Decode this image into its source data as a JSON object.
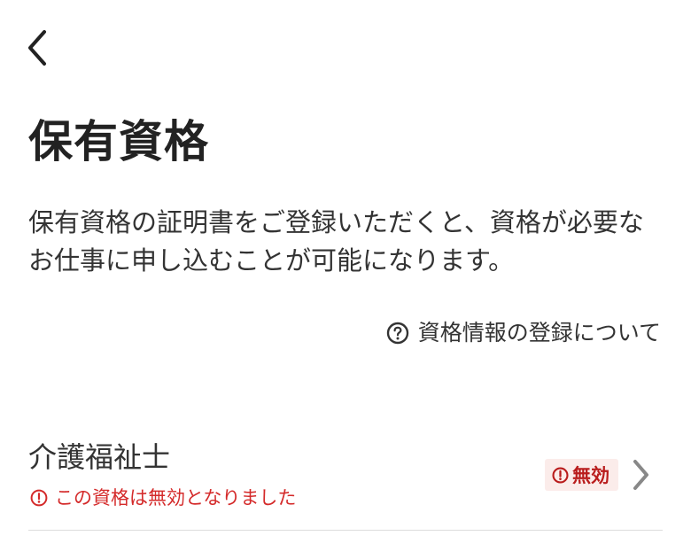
{
  "header": {
    "back_icon": "chevron-left-icon"
  },
  "page": {
    "title": "保有資格",
    "description": "保有資格の証明書をご登録いただくと、資格が必要なお仕事に申し込むことが可能になります。"
  },
  "help_link": {
    "icon": "question-circle-icon",
    "label": "資格情報の登録について"
  },
  "qualifications": [
    {
      "name": "介護福祉士",
      "error_icon": "alert-circle-icon",
      "error_message": "この資格は無効となりました",
      "status_label": "無効",
      "chevron_icon": "chevron-right-icon"
    }
  ],
  "colors": {
    "text_primary": "#222222",
    "error": "#d42a2a",
    "badge_text": "#b91c1c",
    "badge_background": "#fbecea",
    "divider": "#dddddd",
    "chevron": "#888888"
  }
}
